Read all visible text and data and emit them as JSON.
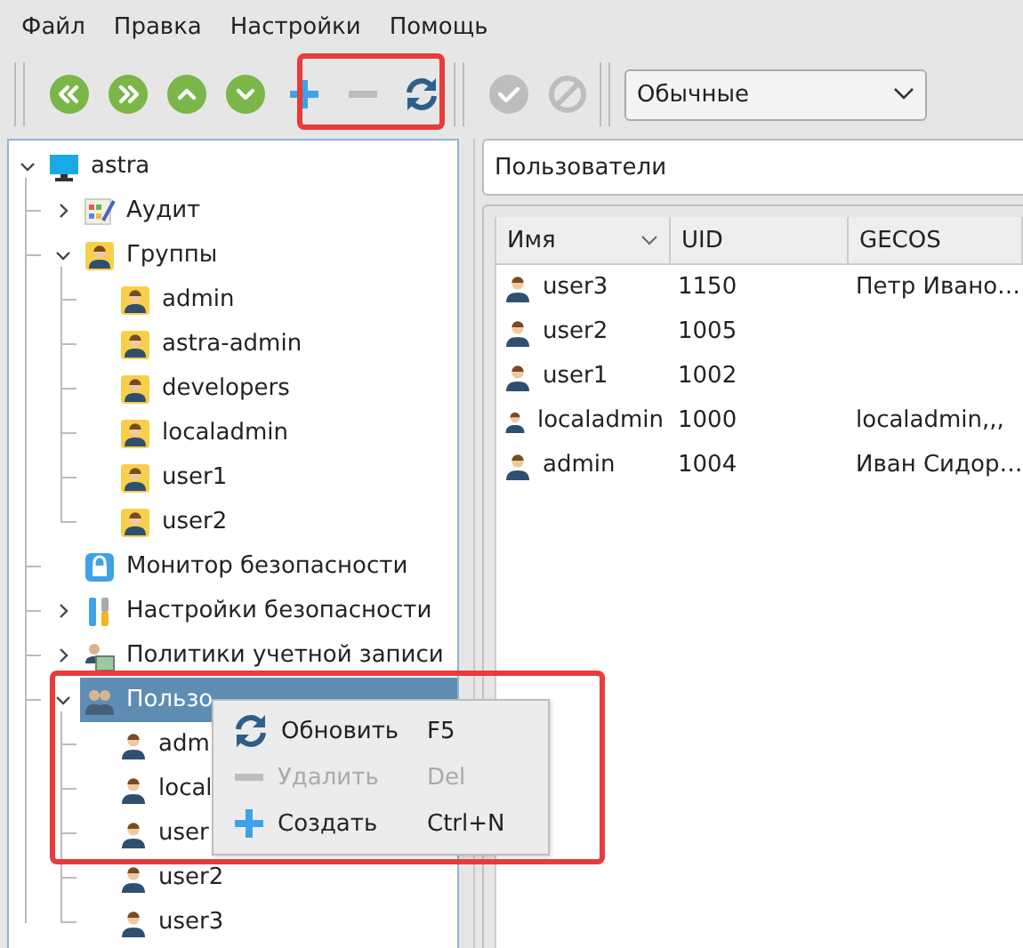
{
  "menu": [
    "Файл",
    "Правка",
    "Настройки",
    "Помощь"
  ],
  "toolbar": [
    {
      "kind": "handle"
    },
    {
      "kind": "first",
      "disabled": false
    },
    {
      "kind": "last",
      "disabled": false
    },
    {
      "kind": "up",
      "disabled": false
    },
    {
      "kind": "down",
      "disabled": false
    },
    {
      "kind": "add",
      "disabled": false
    },
    {
      "kind": "remove",
      "disabled": true
    },
    {
      "kind": "refresh",
      "disabled": false
    },
    {
      "kind": "handle"
    },
    {
      "kind": "apply",
      "disabled": true
    },
    {
      "kind": "cancel",
      "disabled": true
    },
    {
      "kind": "handle"
    },
    {
      "kind": "combo",
      "value": "Обычные"
    }
  ],
  "tree": [
    {
      "label": "astra",
      "kind": "computer",
      "expanded": true,
      "selected": false,
      "children": [
        {
          "label": "Аудит",
          "kind": "audit",
          "expanded": false,
          "selected": false
        },
        {
          "label": "Группы",
          "kind": "group",
          "expanded": true,
          "selected": false,
          "children": [
            {
              "label": "admin",
              "kind": "group",
              "selected": false
            },
            {
              "label": "astra-admin",
              "kind": "group",
              "selected": false
            },
            {
              "label": "developers",
              "kind": "group",
              "selected": false
            },
            {
              "label": "localadmin",
              "kind": "group",
              "selected": false
            },
            {
              "label": "user1",
              "kind": "group",
              "selected": false
            },
            {
              "label": "user2",
              "kind": "group",
              "selected": false
            }
          ]
        },
        {
          "label": "Монитор безопасности",
          "kind": "lock",
          "selected": false
        },
        {
          "label": "Настройки безопасности",
          "kind": "tools",
          "expanded": false,
          "selected": false
        },
        {
          "label": "Политики учетной записи",
          "kind": "policy",
          "expanded": false,
          "selected": false
        },
        {
          "label": "Пользо",
          "kind": "users",
          "expanded": true,
          "selected": true,
          "children": [
            {
              "label": "adm",
              "kind": "user",
              "selected": false
            },
            {
              "label": "local",
              "kind": "user",
              "selected": false
            },
            {
              "label": "user",
              "kind": "user",
              "selected": false
            },
            {
              "label": "user2",
              "kind": "user",
              "selected": false
            },
            {
              "label": "user3",
              "kind": "user",
              "selected": false
            }
          ]
        }
      ]
    }
  ],
  "context_menu": [
    {
      "kind": "refresh",
      "label": "Обновить",
      "shortcut": "F5",
      "disabled": false
    },
    {
      "kind": "remove",
      "label": "Удалить",
      "shortcut": "Del",
      "disabled": true
    },
    {
      "kind": "add",
      "label": "Создать",
      "shortcut": "Ctrl+N",
      "disabled": false
    }
  ],
  "path": "Пользователи",
  "table": {
    "columns": [
      {
        "label": "Имя",
        "sorted": true
      },
      {
        "label": "UID",
        "sorted": false
      },
      {
        "label": "GECOS",
        "sorted": false
      }
    ],
    "rows": [
      [
        "user3",
        "1150",
        "Петр Ивано…"
      ],
      [
        "user2",
        "1005",
        ""
      ],
      [
        "user1",
        "1002",
        ""
      ],
      [
        "localadmin",
        "1000",
        "localadmin,,,"
      ],
      [
        "admin",
        "1004",
        "Иван Сидор…"
      ]
    ]
  }
}
